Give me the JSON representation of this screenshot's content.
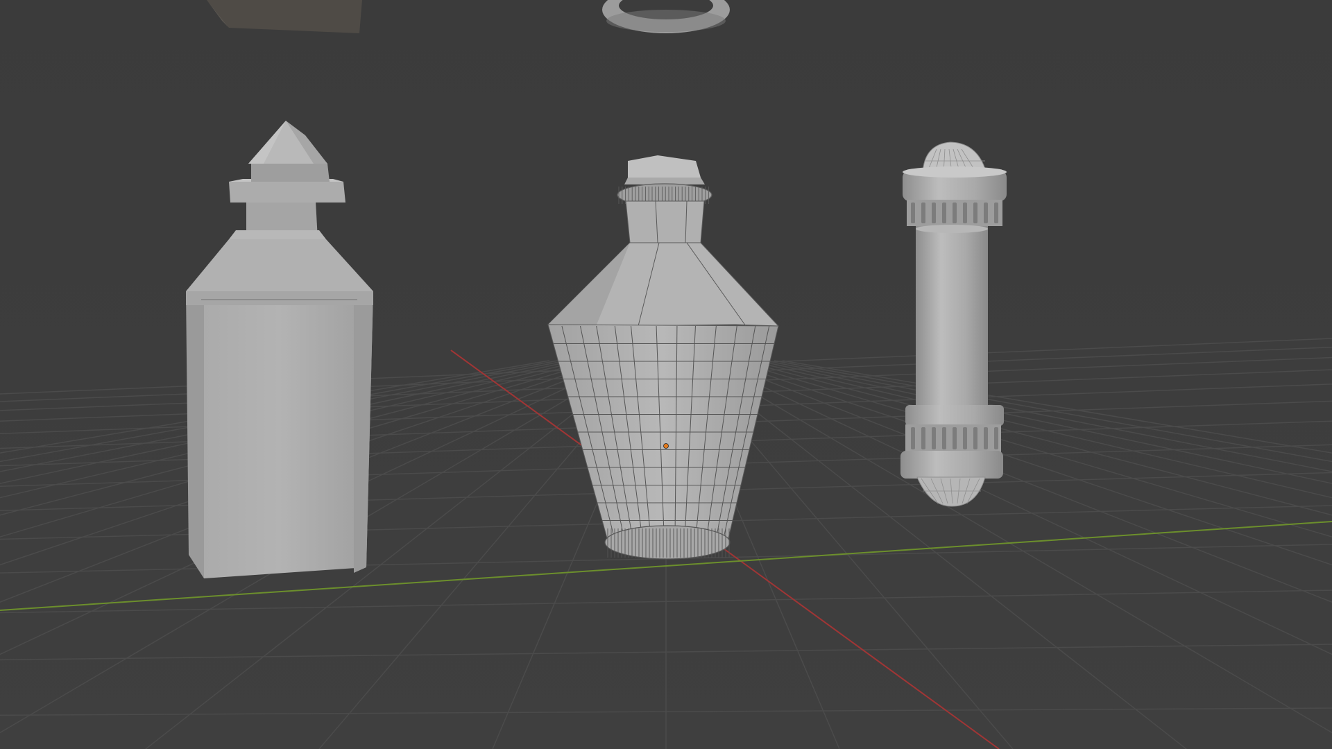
{
  "viewport": {
    "mode": "solid-shading",
    "background": "#3d3d3d",
    "grid_color": "#4a4a4a",
    "x_axis_color": "#b03a3a",
    "y_axis_color": "#6a8f2a",
    "object_color": "#b4b4b4",
    "wire_color": "#5a5a5a",
    "origin_color": "#e07a1e"
  },
  "objects": [
    {
      "name": "square-bottle",
      "selected": false
    },
    {
      "name": "octagonal-potion-bottle",
      "selected": true
    },
    {
      "name": "cylindrical-vial",
      "selected": false
    },
    {
      "name": "box-partial",
      "selected": false
    },
    {
      "name": "torus-ring",
      "selected": false
    }
  ]
}
